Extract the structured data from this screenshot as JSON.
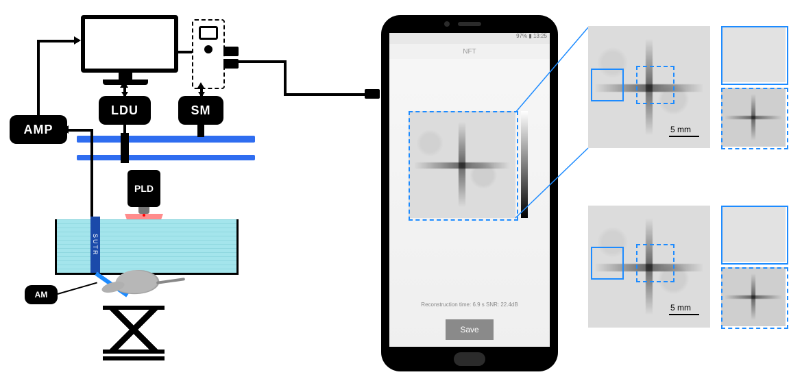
{
  "diagram": {
    "components": {
      "amp": {
        "label": "AMP"
      },
      "ldu": {
        "label": "LDU"
      },
      "sm": {
        "label": "SM"
      },
      "am": {
        "label": "AM"
      },
      "pld": {
        "label": "PLD"
      },
      "sutr": {
        "label": "SUTR"
      }
    },
    "scale": {
      "label": "5 mm"
    }
  },
  "phone": {
    "header_title": "NFT",
    "status_text": "Reconstruction time: 6.9 s  SNR: 22.4dB",
    "save_button": "Save"
  }
}
